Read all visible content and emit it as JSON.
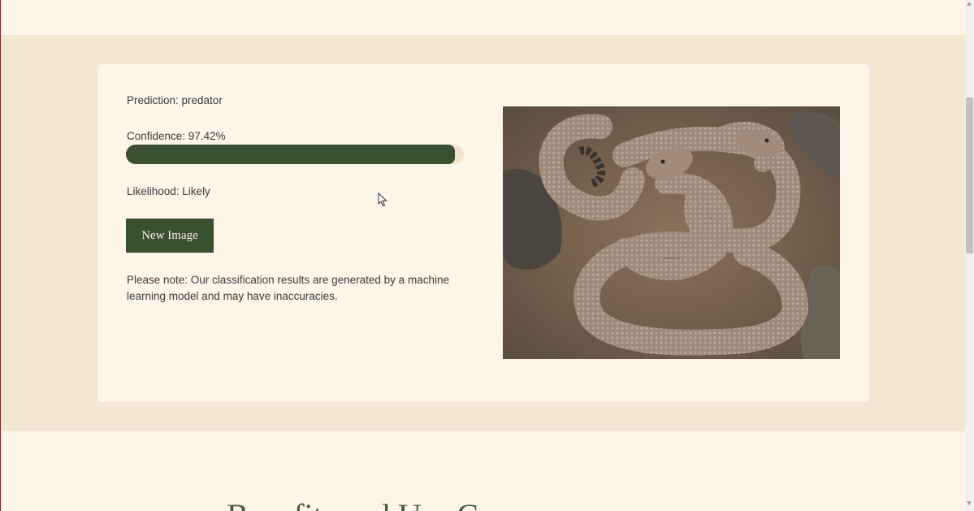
{
  "result": {
    "prediction_label": "Prediction: predator",
    "confidence_label": "Confidence: 97.42%",
    "confidence_value": 97.42,
    "likelihood_label": "Likelihood: Likely",
    "new_image_button": "New Image",
    "note": "Please note: Our classification results are generated by a machine learning model and may have inaccuracies."
  },
  "bottom": {
    "heading": "Benefits and Use Cases"
  },
  "colors": {
    "accent": "#3b5030",
    "card_background": "#fdf5e8",
    "section_background": "#f3e6d3"
  }
}
